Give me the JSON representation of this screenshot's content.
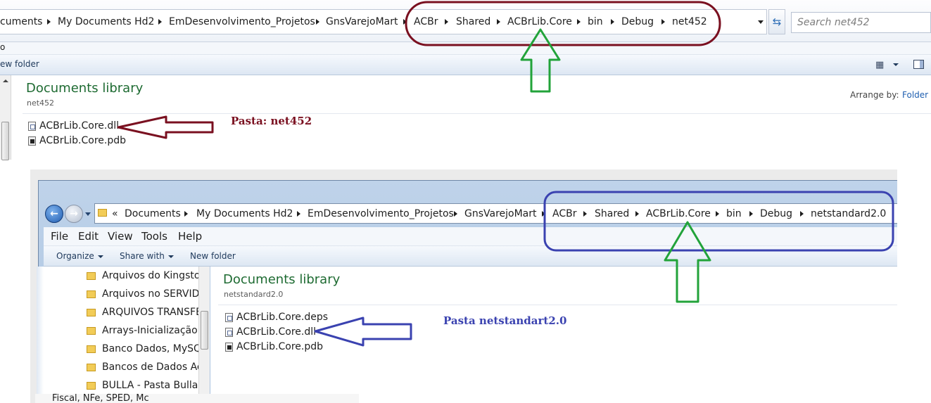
{
  "top_window": {
    "breadcrumb": [
      "cuments",
      "My Documents Hd2",
      "EmDesenvolvimento_Projetos",
      "GnsVarejoMart",
      "ACBr",
      "Shared",
      "ACBrLib.Core",
      "bin",
      "Debug",
      "net452"
    ],
    "search_placeholder": "Search net452",
    "menu_fragment": "o",
    "toolbar_new_folder": "ew folder",
    "library_title": "Documents library",
    "library_subtitle": "net452",
    "arrange_label": "Arrange by:",
    "arrange_value": "Folder",
    "files": [
      {
        "name": "ACBrLib.Core.dll",
        "icon": "dll-file-icon"
      },
      {
        "name": "ACBrLib.Core.pdb",
        "icon": "pdb-file-icon"
      }
    ]
  },
  "annotations": {
    "top_label": "Pasta: net452",
    "bottom_label": "Pasta netstandart2.0",
    "top_color": "#7a1020",
    "bottom_color": "#3a42b0",
    "green_color": "#22a33a"
  },
  "bottom_window": {
    "breadcrumb_prefix": "«",
    "breadcrumb": [
      "Documents",
      "My Documents Hd2",
      "EmDesenvolvimento_Projetos",
      "GnsVarejoMart",
      "ACBr",
      "Shared",
      "ACBrLib.Core",
      "bin",
      "Debug",
      "netstandard2.0"
    ],
    "menu": [
      "File",
      "Edit",
      "View",
      "Tools",
      "Help"
    ],
    "toolbar": {
      "organize": "Organize",
      "share_with": "Share with",
      "new_folder": "New folder"
    },
    "folders": [
      "Arquivos do Kingston",
      "Arquivos no SERVIDOR",
      "ARQUIVOS TRANSFERIDOS",
      "Arrays-Inicialização",
      "Banco Dados, MySQL",
      "Bancos de Dados Ac",
      "BULLA - Pasta Bulla"
    ],
    "library_title": "Documents library",
    "library_subtitle": "netstandard2.0",
    "files": [
      {
        "name": "ACBrLib.Core.deps",
        "icon": "deps-file-icon"
      },
      {
        "name": "ACBrLib.Core.dll",
        "icon": "dll-file-icon"
      },
      {
        "name": "ACBrLib.Core.pdb",
        "icon": "pdb-file-icon"
      }
    ]
  },
  "footer_fragment": "Fiscal, NFe, SPED, Mc"
}
